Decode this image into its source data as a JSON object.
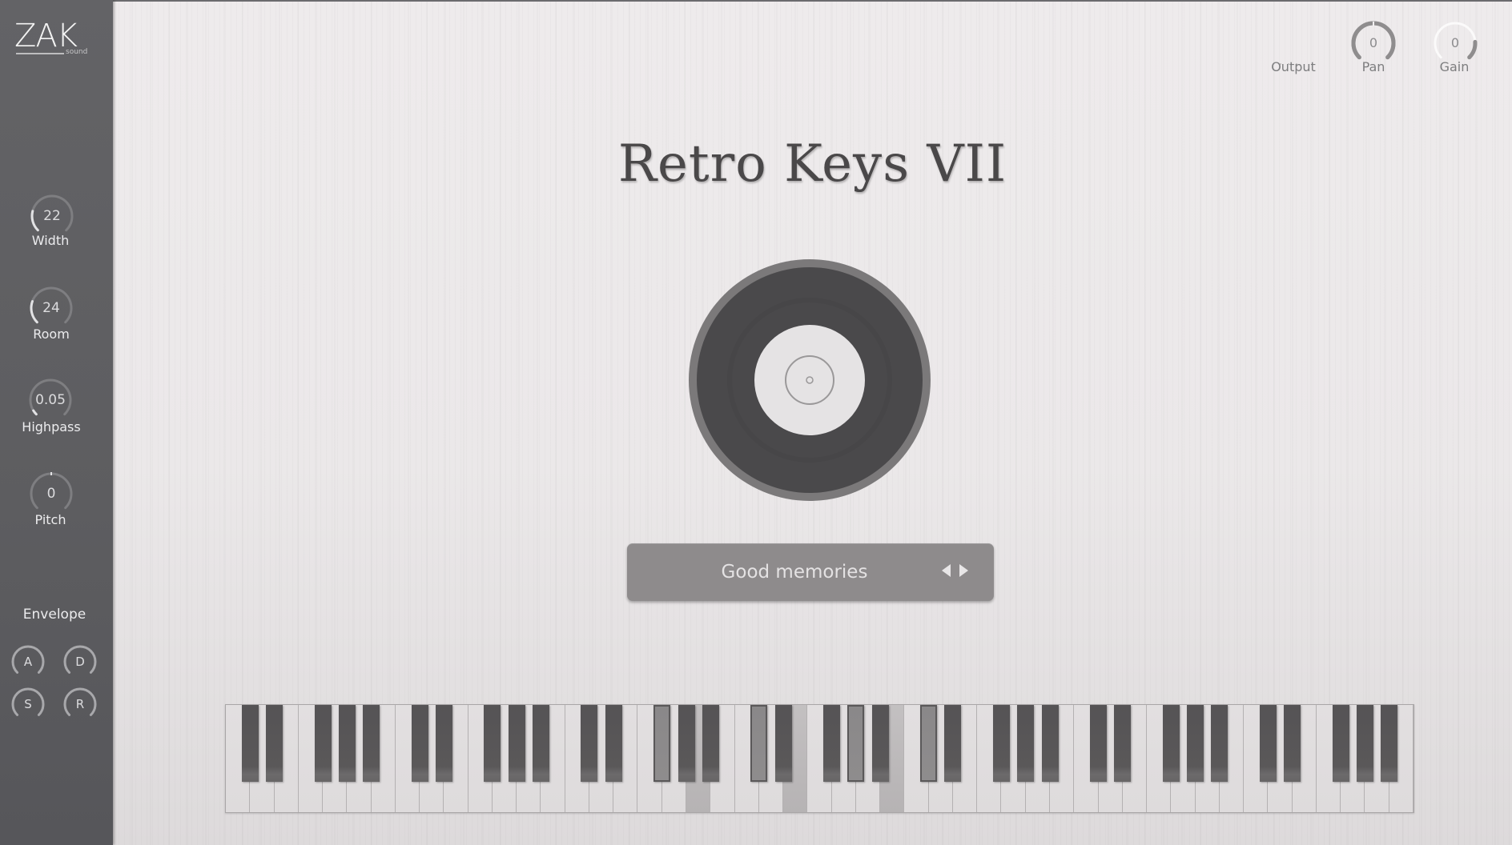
{
  "brand": {
    "logo_text": "ZAK",
    "logo_sub": "sound"
  },
  "app_title": "Retro Keys VII",
  "sidebar": {
    "knobs": [
      {
        "name": "width",
        "label": "Width",
        "value": "22",
        "fraction": 0.22
      },
      {
        "name": "room",
        "label": "Room",
        "value": "24",
        "fraction": 0.24
      },
      {
        "name": "highpass",
        "label": "Highpass",
        "value": "0.05",
        "fraction": 0.05
      },
      {
        "name": "pitch",
        "label": "Pitch",
        "value": "0",
        "fraction": 0.5
      }
    ],
    "envelope": {
      "title": "Envelope",
      "knobs": [
        {
          "name": "attack",
          "label": "A"
        },
        {
          "name": "decay",
          "label": "D"
        },
        {
          "name": "sustain",
          "label": "S"
        },
        {
          "name": "release",
          "label": "R"
        }
      ]
    }
  },
  "output": {
    "label": "Output",
    "knobs": [
      {
        "name": "pan",
        "label": "Pan",
        "value": "0",
        "fraction": 0.5
      },
      {
        "name": "gain",
        "label": "Gain",
        "value": "0",
        "fraction": 0.85
      }
    ]
  },
  "preset": {
    "name": "Good memories",
    "prev_icon": "triangle-left",
    "next_icon": "triangle-right"
  },
  "keyboard": {
    "white_key_count": 49,
    "first_note": "C",
    "pressed_white_indices": [
      19,
      23,
      27
    ],
    "pressed_black_notes": [
      "F#2",
      "C#3",
      "G#3",
      "C#4"
    ]
  },
  "colors": {
    "sidebar": "#5f5f62",
    "background": "#ebe8e9",
    "title": "#4a4849",
    "preset_bar": "#8e8b8c",
    "record": "#4a494b"
  }
}
